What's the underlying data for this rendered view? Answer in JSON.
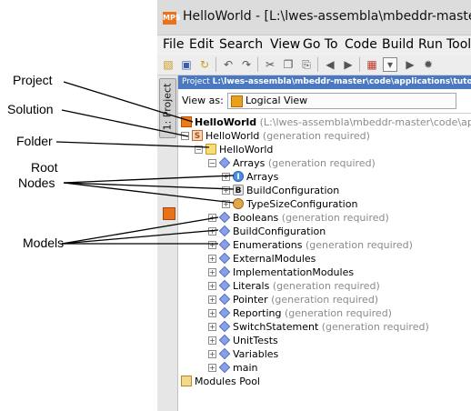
{
  "window": {
    "app_icon_text": "MPS",
    "title": "HelloWorld - [L:\\lwes-assembla\\mbeddr-master\\code\\applications\\tutorial]"
  },
  "menu": [
    "File",
    "Edit",
    "Search",
    "View",
    "Go To",
    "Code",
    "Build",
    "Run",
    "Tools"
  ],
  "toolbar_icons": [
    "open-icon",
    "save-icon",
    "sync-icon",
    "undo-icon",
    "redo-icon",
    "cut-icon",
    "copy-icon",
    "paste-icon",
    "back-icon",
    "forward-icon",
    "layout-icon",
    "dropdown-icon",
    "run-icon",
    "debug-icon"
  ],
  "side_tab": {
    "label": "1: Project"
  },
  "panel": {
    "header_prefix": "Project",
    "header_path": "L:\\lwes-assembla\\mbeddr-master\\code\\applications\\tutorial",
    "view_as_label": "View as:",
    "view_as_value": "Logical View"
  },
  "tree": {
    "project": {
      "name": "HelloWorld",
      "path": "(L:\\lwes-assembla\\mbeddr-master\\code\\applications\\tutorial)"
    },
    "solution": {
      "name": "HelloWorld",
      "note": "(generation required)"
    },
    "folder": {
      "name": "HelloWorld"
    },
    "arrays": {
      "name": "Arrays",
      "note": "(generation required)"
    },
    "root_nodes": [
      {
        "name": "Arrays",
        "icon": "I"
      },
      {
        "name": "BuildConfiguration",
        "icon": "B"
      },
      {
        "name": "TypeSizeConfiguration",
        "icon": ""
      }
    ],
    "models": [
      {
        "name": "Booleans",
        "note": "(generation required)"
      },
      {
        "name": "BuildConfiguration",
        "note": ""
      },
      {
        "name": "Enumerations",
        "note": "(generation required)"
      },
      {
        "name": "ExternalModules",
        "note": ""
      },
      {
        "name": "ImplementationModules",
        "note": ""
      },
      {
        "name": "Literals",
        "note": "(generation required)"
      },
      {
        "name": "Pointer",
        "note": "(generation required)"
      },
      {
        "name": "Reporting",
        "note": "(generation required)"
      },
      {
        "name": "SwitchStatement",
        "note": "(generation required)"
      },
      {
        "name": "UnitTests",
        "note": ""
      },
      {
        "name": "Variables",
        "note": ""
      },
      {
        "name": "main",
        "note": ""
      }
    ],
    "modules_pool": "Modules Pool"
  },
  "callouts": {
    "project": "Project",
    "solution": "Solution",
    "folder": "Folder",
    "root_line1": "Root",
    "root_line2": "Nodes",
    "models": "Models"
  }
}
